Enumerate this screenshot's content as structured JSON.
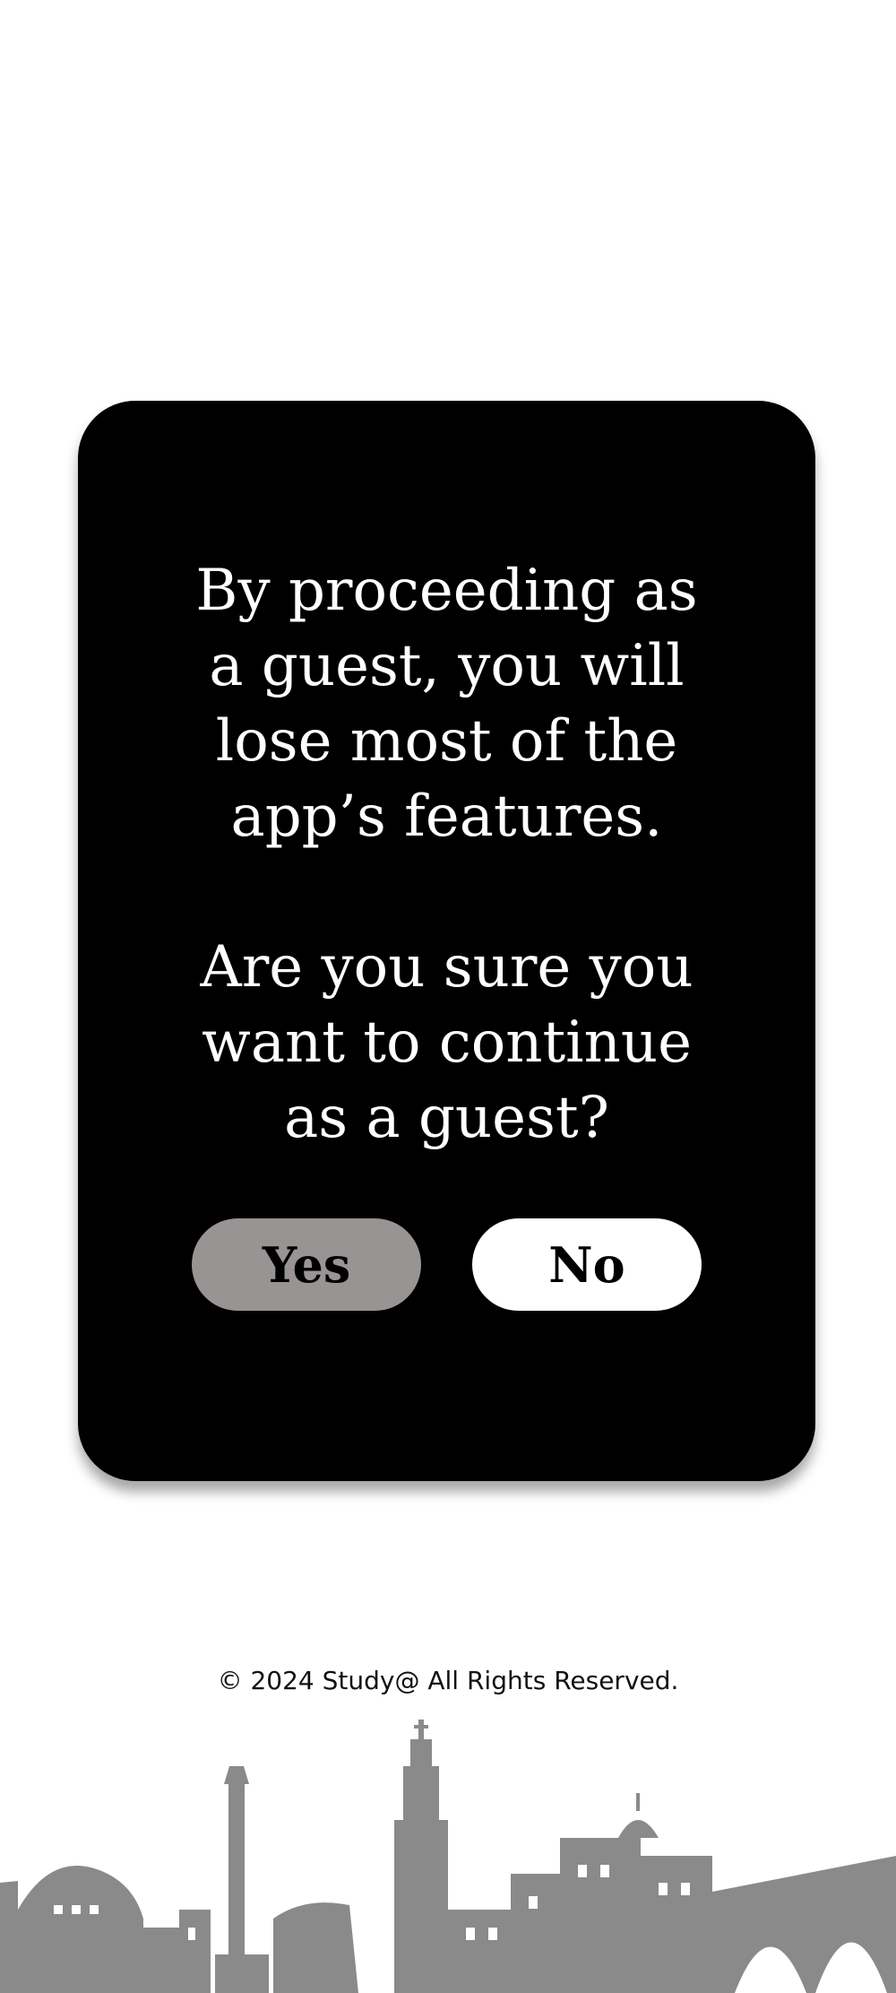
{
  "dialog": {
    "message": "By proceeding as a guest, you will lose most of the app’s features.",
    "question": "Are you sure you want to continue as a guest?",
    "yes_label": "Yes",
    "no_label": "No"
  },
  "footer": {
    "copyright": "© 2024 Study@ All Rights Reserved."
  },
  "colors": {
    "dialog_bg": "#000000",
    "yes_button": "#989494",
    "no_button": "#ffffff",
    "skyline": "#8a8a8a"
  }
}
